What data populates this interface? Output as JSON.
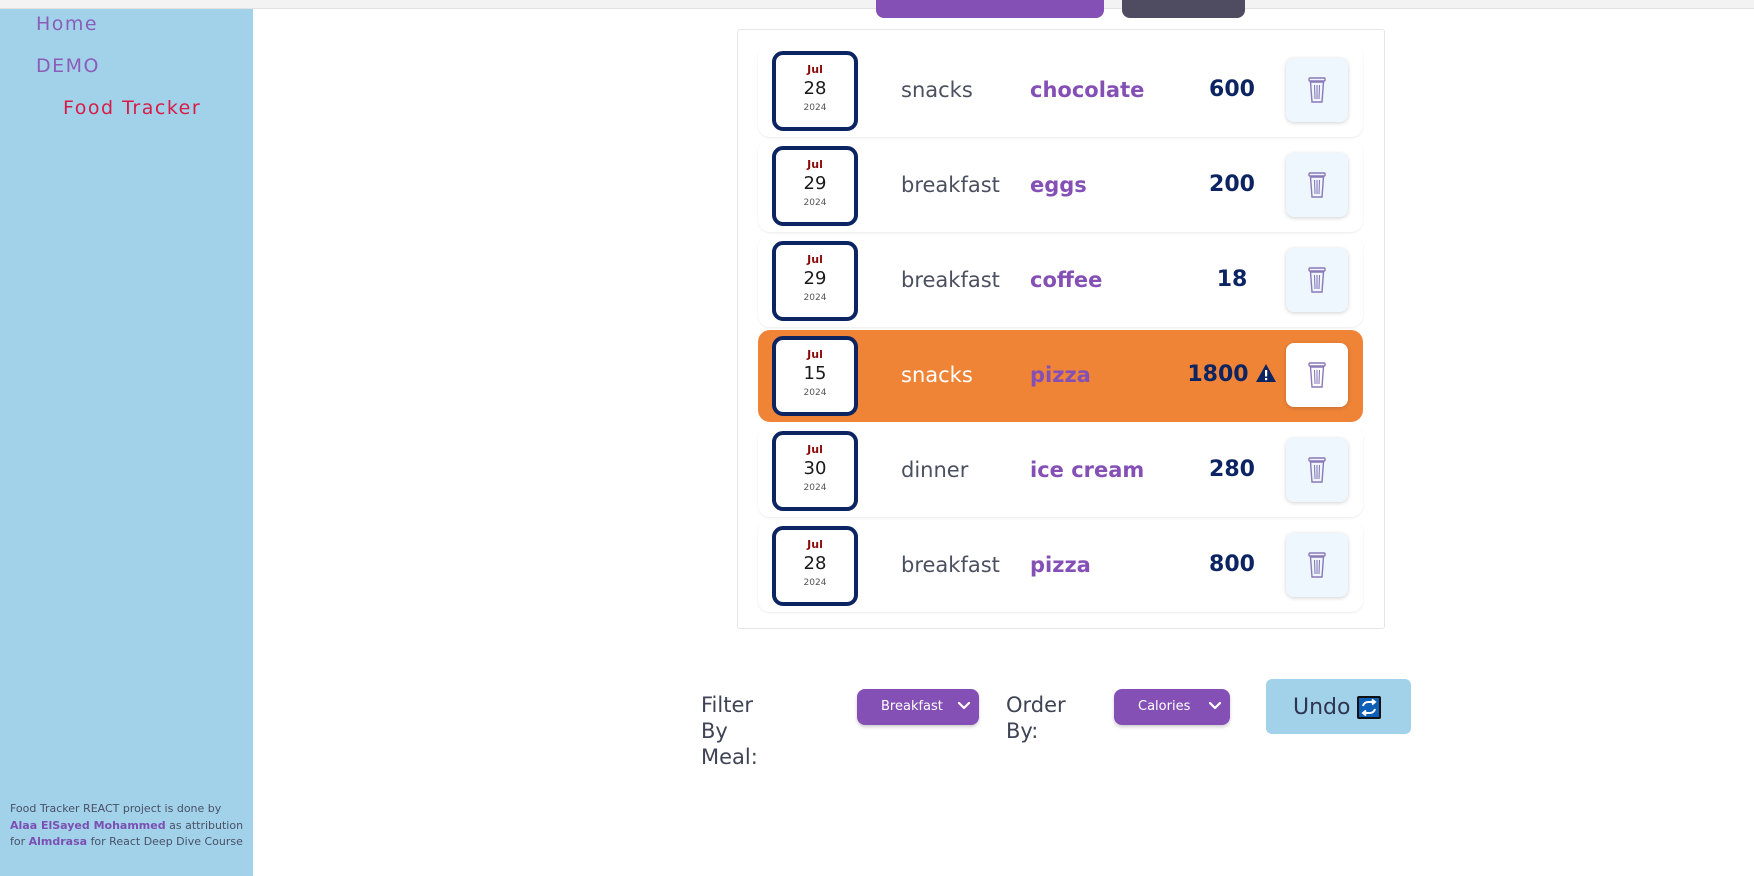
{
  "sidebar": {
    "items": [
      {
        "label": "Home"
      },
      {
        "label": "DEMO"
      },
      {
        "label": "Food Tracker"
      }
    ],
    "attribution": {
      "line1": "Food Tracker REACT project is done by",
      "author": "Alaa ElSayed Mohammed",
      "line2": "as attribution",
      "for1": "for",
      "org": "Almdrasa",
      "line3": "for React Deep Dive Course"
    }
  },
  "entries": [
    {
      "month": "Jul",
      "day": "28",
      "year": "2024",
      "meal": "snacks",
      "food": "chocolate",
      "calories": "600",
      "warning": false
    },
    {
      "month": "Jul",
      "day": "29",
      "year": "2024",
      "meal": "breakfast",
      "food": "eggs",
      "calories": "200",
      "warning": false
    },
    {
      "month": "Jul",
      "day": "29",
      "year": "2024",
      "meal": "breakfast",
      "food": "coffee",
      "calories": "18",
      "warning": false
    },
    {
      "month": "Jul",
      "day": "15",
      "year": "2024",
      "meal": "snacks",
      "food": "pizza",
      "calories": "1800",
      "warning": true
    },
    {
      "month": "Jul",
      "day": "30",
      "year": "2024",
      "meal": "dinner",
      "food": "ice cream",
      "calories": "280",
      "warning": false
    },
    {
      "month": "Jul",
      "day": "28",
      "year": "2024",
      "meal": "breakfast",
      "food": "pizza",
      "calories": "800",
      "warning": false
    }
  ],
  "controls": {
    "filter_label": "Filter By Meal:",
    "filter_value": "Breakfast",
    "order_label": "Order By:",
    "order_value": "Calories",
    "undo_label": "Undo"
  },
  "icons": {
    "trash": "trash-icon",
    "warning": "warning-icon",
    "dropdown": "chevron-down-icon",
    "undo": "undo-icon"
  },
  "colors": {
    "sidebar_bg": "#a1d2ea",
    "accent_purple": "#8550b5",
    "navy": "#0d2462",
    "warning_orange": "#ef8437",
    "active_nav": "#d81b47"
  }
}
